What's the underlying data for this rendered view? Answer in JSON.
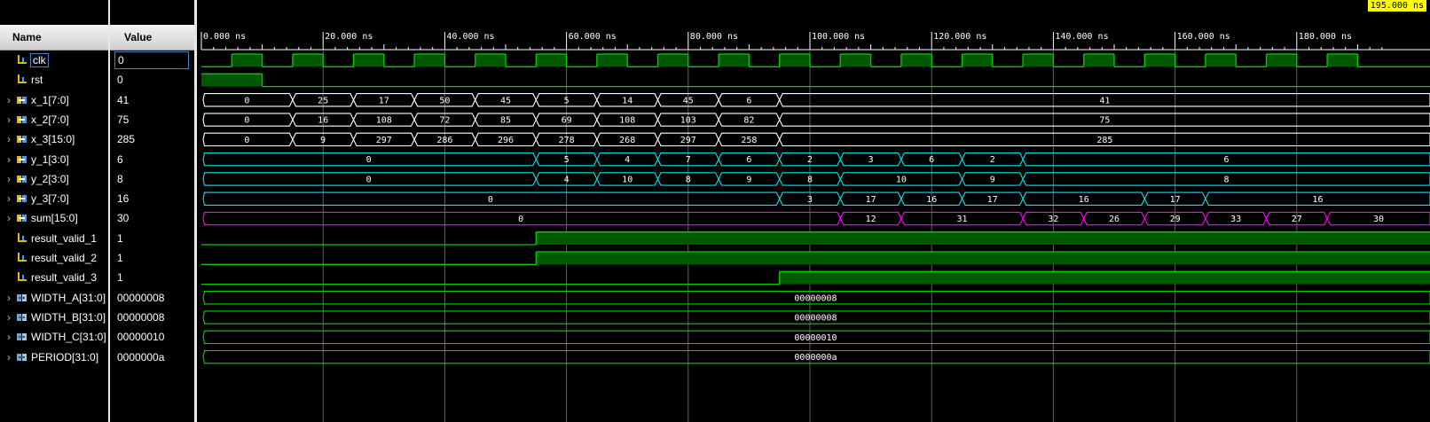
{
  "header": {
    "name_label": "Name",
    "value_label": "Value"
  },
  "cursor_time": "195.000 ns",
  "time_axis": {
    "unit": "ns",
    "start": 0,
    "end": 195,
    "major_labels": [
      "0.000 ns",
      "20.000 ns",
      "40.000 ns",
      "60.000 ns",
      "80.000 ns",
      "100.000 ns",
      "120.000 ns",
      "140.000 ns",
      "160.000 ns",
      "180.000 ns"
    ]
  },
  "signals": [
    {
      "name": "clk",
      "value": "0",
      "kind": "bit",
      "icon": "bit-signal-icon",
      "color": "#00d000",
      "expandable": false,
      "selected": true,
      "clock": {
        "period": 10,
        "high_first": false
      }
    },
    {
      "name": "rst",
      "value": "0",
      "kind": "bit",
      "icon": "bit-signal-icon",
      "color": "#00d000",
      "expandable": false,
      "edges": [
        [
          0,
          1
        ],
        [
          10,
          0
        ]
      ]
    },
    {
      "name": "x_1[7:0]",
      "value": "41",
      "kind": "bus",
      "icon": "bus-signal-icon",
      "color": "#ffffff",
      "expandable": true,
      "segments": [
        [
          0,
          "0"
        ],
        [
          15,
          "25"
        ],
        [
          25,
          "17"
        ],
        [
          35,
          "50"
        ],
        [
          45,
          "45"
        ],
        [
          55,
          "5"
        ],
        [
          65,
          "14"
        ],
        [
          75,
          "45"
        ],
        [
          85,
          "6"
        ],
        [
          95,
          "41"
        ]
      ]
    },
    {
      "name": "x_2[7:0]",
      "value": "75",
      "kind": "bus",
      "icon": "bus-signal-icon",
      "color": "#ffffff",
      "expandable": true,
      "segments": [
        [
          0,
          "0"
        ],
        [
          15,
          "16"
        ],
        [
          25,
          "108"
        ],
        [
          35,
          "72"
        ],
        [
          45,
          "85"
        ],
        [
          55,
          "69"
        ],
        [
          65,
          "108"
        ],
        [
          75,
          "103"
        ],
        [
          85,
          "82"
        ],
        [
          95,
          "75"
        ]
      ]
    },
    {
      "name": "x_3[15:0]",
      "value": "285",
      "kind": "bus",
      "icon": "bus-signal-icon",
      "color": "#ffffff",
      "expandable": true,
      "segments": [
        [
          0,
          "0"
        ],
        [
          15,
          "9"
        ],
        [
          25,
          "297"
        ],
        [
          35,
          "286"
        ],
        [
          45,
          "296"
        ],
        [
          55,
          "278"
        ],
        [
          65,
          "268"
        ],
        [
          75,
          "297"
        ],
        [
          85,
          "258"
        ],
        [
          95,
          "285"
        ]
      ]
    },
    {
      "name": "y_1[3:0]",
      "value": "6",
      "kind": "bus",
      "icon": "bus-signal-icon",
      "color": "#00e5e5",
      "expandable": true,
      "segments": [
        [
          0,
          "0"
        ],
        [
          55,
          "5"
        ],
        [
          65,
          "4"
        ],
        [
          75,
          "7"
        ],
        [
          85,
          "6"
        ],
        [
          95,
          "2"
        ],
        [
          105,
          "3"
        ],
        [
          115,
          "6"
        ],
        [
          125,
          "2"
        ],
        [
          135,
          "6"
        ]
      ]
    },
    {
      "name": "y_2[3:0]",
      "value": "8",
      "kind": "bus",
      "icon": "bus-signal-icon",
      "color": "#00e5e5",
      "expandable": true,
      "segments": [
        [
          0,
          "0"
        ],
        [
          55,
          "4"
        ],
        [
          65,
          "10"
        ],
        [
          75,
          "8"
        ],
        [
          85,
          "9"
        ],
        [
          95,
          "8"
        ],
        [
          105,
          "10"
        ],
        [
          125,
          "9"
        ],
        [
          135,
          "8"
        ]
      ]
    },
    {
      "name": "y_3[7:0]",
      "value": "16",
      "kind": "bus",
      "icon": "bus-signal-icon",
      "color": "#00e5e5",
      "expandable": true,
      "segments": [
        [
          0,
          "0"
        ],
        [
          95,
          "3"
        ],
        [
          105,
          "17"
        ],
        [
          115,
          "16"
        ],
        [
          125,
          "17"
        ],
        [
          135,
          "16"
        ],
        [
          155,
          "17"
        ],
        [
          165,
          "16"
        ]
      ]
    },
    {
      "name": "sum[15:0]",
      "value": "30",
      "kind": "bus",
      "icon": "bus-signal-icon",
      "color": "#ff00ff",
      "expandable": true,
      "segments": [
        [
          0,
          "0"
        ],
        [
          105,
          "12"
        ],
        [
          115,
          "31"
        ],
        [
          135,
          "32"
        ],
        [
          145,
          "26"
        ],
        [
          155,
          "29"
        ],
        [
          165,
          "33"
        ],
        [
          175,
          "27"
        ],
        [
          185,
          "30"
        ]
      ]
    },
    {
      "name": "result_valid_1",
      "value": "1",
      "kind": "bit",
      "icon": "bit-signal-icon",
      "color": "#00d000",
      "expandable": false,
      "edges": [
        [
          0,
          0
        ],
        [
          55,
          1
        ]
      ]
    },
    {
      "name": "result_valid_2",
      "value": "1",
      "kind": "bit",
      "icon": "bit-signal-icon",
      "color": "#00d000",
      "expandable": false,
      "edges": [
        [
          0,
          0
        ],
        [
          55,
          1
        ]
      ]
    },
    {
      "name": "result_valid_3",
      "value": "1",
      "kind": "bit",
      "icon": "bit-signal-icon",
      "color": "#00d000",
      "expandable": false,
      "edges": [
        [
          0,
          0
        ],
        [
          95,
          1
        ]
      ]
    },
    {
      "name": "WIDTH_A[31:0]",
      "value": "00000008",
      "kind": "bus",
      "icon": "parameter-icon",
      "color": "#00d000",
      "expandable": true,
      "segments": [
        [
          0,
          "00000008"
        ]
      ]
    },
    {
      "name": "WIDTH_B[31:0]",
      "value": "00000008",
      "kind": "bus",
      "icon": "parameter-icon",
      "color": "#00d000",
      "expandable": true,
      "segments": [
        [
          0,
          "00000008"
        ]
      ]
    },
    {
      "name": "WIDTH_C[31:0]",
      "value": "00000010",
      "kind": "bus",
      "icon": "parameter-icon",
      "color": "#00d000",
      "expandable": true,
      "segments": [
        [
          0,
          "00000010"
        ]
      ]
    },
    {
      "name": "PERIOD[31:0]",
      "value": "0000000a",
      "kind": "bus",
      "icon": "parameter-icon",
      "color": "#00d000",
      "expandable": true,
      "segments": [
        [
          0,
          "0000000a"
        ]
      ]
    }
  ]
}
